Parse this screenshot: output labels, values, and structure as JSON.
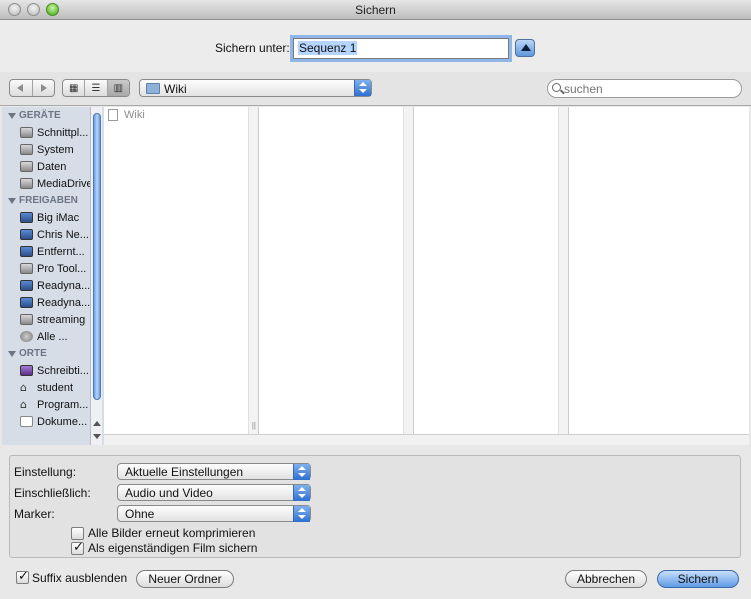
{
  "window": {
    "title": "Sichern"
  },
  "save": {
    "label": "Sichern unter:",
    "filename": "Sequenz 1"
  },
  "toolbar": {
    "nav": [
      "back-arrow",
      "forward-arrow"
    ],
    "views": [
      "icon-view",
      "list-view",
      "column-view"
    ],
    "location": "Wiki",
    "search_placeholder": "suchen"
  },
  "sidebar": {
    "sections": [
      {
        "title": "GERÄTE",
        "items": [
          {
            "label": "Schnittpl...",
            "icon": "disk"
          },
          {
            "label": "System",
            "icon": "disk"
          },
          {
            "label": "Daten",
            "icon": "disk"
          },
          {
            "label": "MediaDrive",
            "icon": "disk"
          }
        ]
      },
      {
        "title": "FREIGABEN",
        "items": [
          {
            "label": "Big iMac",
            "icon": "mac"
          },
          {
            "label": "Chris Ne...",
            "icon": "mac"
          },
          {
            "label": "Entfernt...",
            "icon": "mac"
          },
          {
            "label": "Pro Tool...",
            "icon": "disk"
          },
          {
            "label": "Readyna...",
            "icon": "mac"
          },
          {
            "label": "Readyna...",
            "icon": "mac"
          },
          {
            "label": "streaming",
            "icon": "disk"
          },
          {
            "label": "Alle ...",
            "icon": "globe"
          }
        ]
      },
      {
        "title": "ORTE",
        "items": [
          {
            "label": "Schreibti...",
            "icon": "desk"
          },
          {
            "label": "student",
            "icon": "home"
          },
          {
            "label": "Program...",
            "icon": "home"
          },
          {
            "label": "Dokume...",
            "icon": "doc"
          }
        ]
      }
    ]
  },
  "browser": {
    "column1_items": [
      "Wiki"
    ]
  },
  "options": {
    "einstellung": {
      "label": "Einstellung:",
      "value": "Aktuelle Einstellungen"
    },
    "einschliesslich": {
      "label": "Einschließlich:",
      "value": "Audio und Video"
    },
    "marker": {
      "label": "Marker:",
      "value": "Ohne"
    },
    "recompress": {
      "label": "Alle Bilder erneut komprimieren",
      "checked": false
    },
    "selfcontained": {
      "label": "Als eigenständigen Film sichern",
      "checked": true
    }
  },
  "footer": {
    "hide_suffix": {
      "label": "Suffix ausblenden",
      "checked": true
    },
    "new_folder": "Neuer Ordner",
    "cancel": "Abbrechen",
    "save": "Sichern"
  }
}
